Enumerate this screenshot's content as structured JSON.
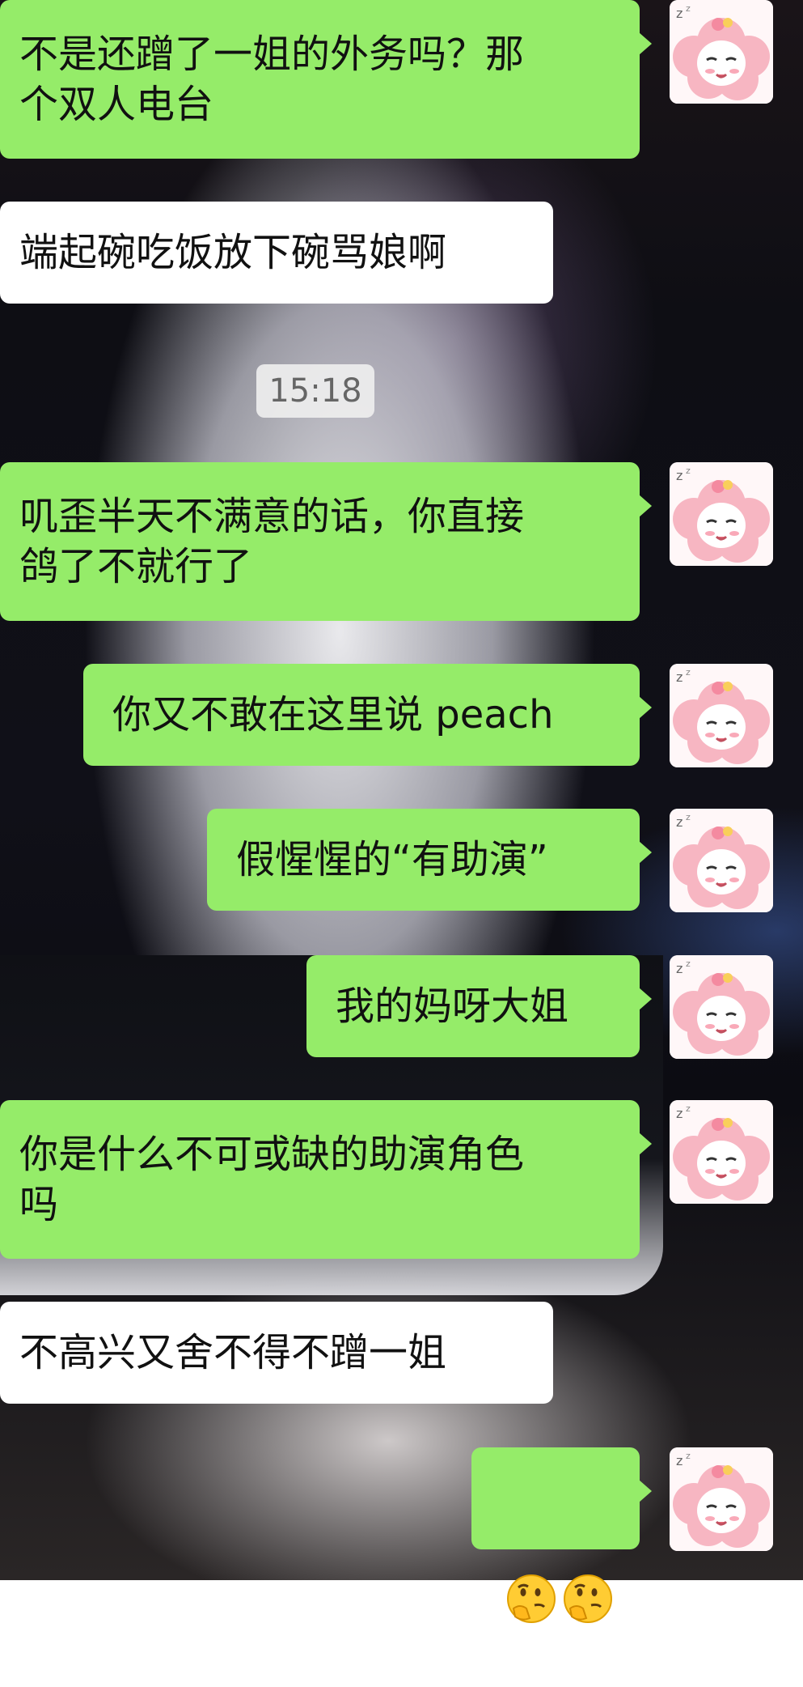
{
  "timestamp": "15:18",
  "avatar_icon": "pink-sleeping-sheep-avatar-icon",
  "messages": [
    {
      "side": "right",
      "text": "不是还蹭了一姐的外务吗？那\n个双人电台"
    },
    {
      "side": "left",
      "text": "端起碗吃饭放下碗骂娘啊"
    },
    {
      "side": "right",
      "text": "叽歪半天不满意的话，你直接\n鸽了不就行了"
    },
    {
      "side": "right",
      "text": "你又不敢在这里说 peach"
    },
    {
      "side": "right",
      "text": "假惺惺的“有助演”"
    },
    {
      "side": "right",
      "text": "我的妈呀大姐"
    },
    {
      "side": "right",
      "text": "你是什么不可或缺的助演角色\n吗"
    },
    {
      "side": "left",
      "text": "不高兴又舍不得不蹭一姐"
    },
    {
      "side": "right",
      "text": "",
      "emoji": [
        "thinking-face-icon",
        "thinking-face-icon"
      ]
    }
  ],
  "colors": {
    "bubble_green": "#95ec69",
    "bubble_white": "#ffffff",
    "timestamp_bg": "#eeeeee",
    "timestamp_text": "#666666"
  }
}
